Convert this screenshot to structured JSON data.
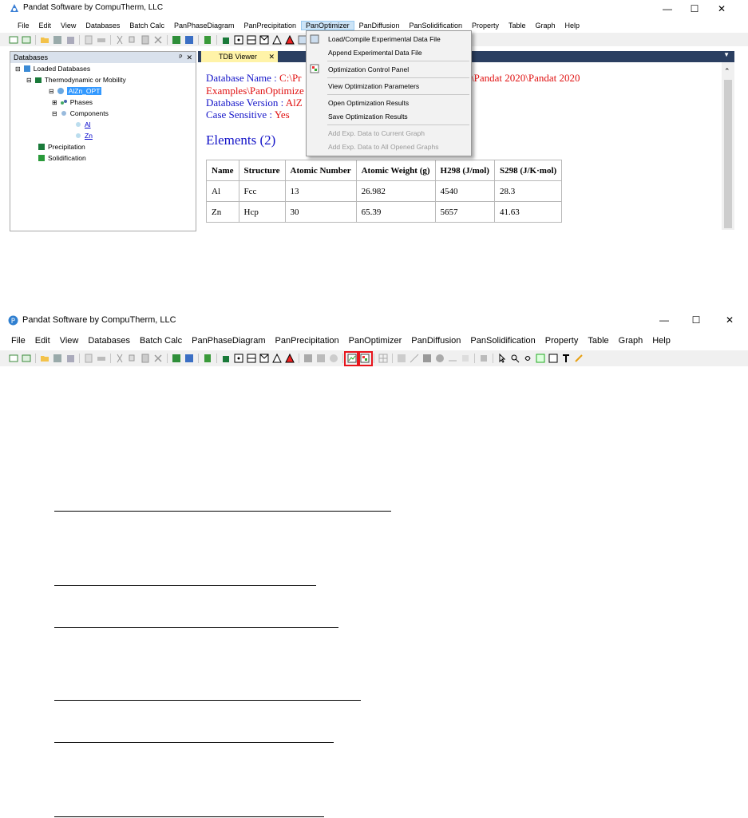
{
  "window1": {
    "title": "Pandat Software by CompuTherm, LLC",
    "controls": {
      "min": "—",
      "max": "☐",
      "close": "✕"
    },
    "menu": [
      "File",
      "Edit",
      "View",
      "Databases",
      "Batch Calc",
      "PanPhaseDiagram",
      "PanPrecipitation",
      "PanOptimizer",
      "PanDiffusion",
      "PanSolidification",
      "Property",
      "Table",
      "Graph",
      "Help"
    ],
    "open_menu": "PanOptimizer",
    "dropdown": {
      "items": [
        {
          "label": "Load/Compile Experimental Data File",
          "enabled": true
        },
        {
          "label": "Append Experimental Data File",
          "enabled": true
        },
        {
          "label": "Optimization Control Panel",
          "enabled": true
        },
        {
          "label": "View Optimization Parameters",
          "enabled": true
        },
        {
          "label": "Open Optimization Results",
          "enabled": true
        },
        {
          "label": "Save Optimization Results",
          "enabled": true
        },
        {
          "label": "Add Exp. Data to Current Graph",
          "enabled": false
        },
        {
          "label": "Add Exp. Data to All Opened Graphs",
          "enabled": false
        }
      ]
    },
    "db_panel": {
      "header": "Databases",
      "pin": "ᴾ",
      "close": "✕",
      "tree": {
        "root": "Loaded Databases",
        "type": "Thermodynamic or Mobility",
        "database": "AlZn_OPT",
        "phases": "Phases",
        "components": "Components",
        "comp_al": "Al",
        "comp_zn": "Zn",
        "precipitation": "Precipitation",
        "solidification": "Solidification"
      }
    },
    "tab": {
      "label": "TDB Viewer",
      "close": "✕"
    },
    "tdb": {
      "line1_label": "Database Name : ",
      "line1_value": "C:\\Pr",
      "line1_tail": "\\Pandat 2020\\Pandat 2020",
      "line2": "Examples\\PanOptimize",
      "line3_label": "Database Version : ",
      "line3_value": "AlZ",
      "line4_label": "Case Sensitive : ",
      "line4_value": "Yes",
      "elements_heading": "Elements (2)",
      "table": {
        "headers": [
          "Name",
          "Structure",
          "Atomic Number",
          "Atomic Weight (g)",
          "H298 (J/mol)",
          "S298 (J/K·mol)"
        ],
        "rows": [
          [
            "Al",
            "Fcc",
            "13",
            "26.982",
            "4540",
            "28.3"
          ],
          [
            "Zn",
            "Hcp",
            "30",
            "65.39",
            "5657",
            "41.63"
          ]
        ]
      }
    }
  },
  "window2": {
    "title": "Pandat Software by CompuTherm, LLC",
    "controls": {
      "min": "—",
      "max": "☐",
      "close": "✕"
    },
    "menu": [
      "File",
      "Edit",
      "View",
      "Databases",
      "Batch Calc",
      "PanPhaseDiagram",
      "PanPrecipitation",
      "PanOptimizer",
      "PanDiffusion",
      "PanSolidification",
      "Property",
      "Table",
      "Graph",
      "Help"
    ]
  },
  "colors": {
    "highlight": "#e8141c",
    "selection": "#3399ff",
    "panel_header": "#d9e1ec",
    "tab_active": "#fff3a8"
  }
}
